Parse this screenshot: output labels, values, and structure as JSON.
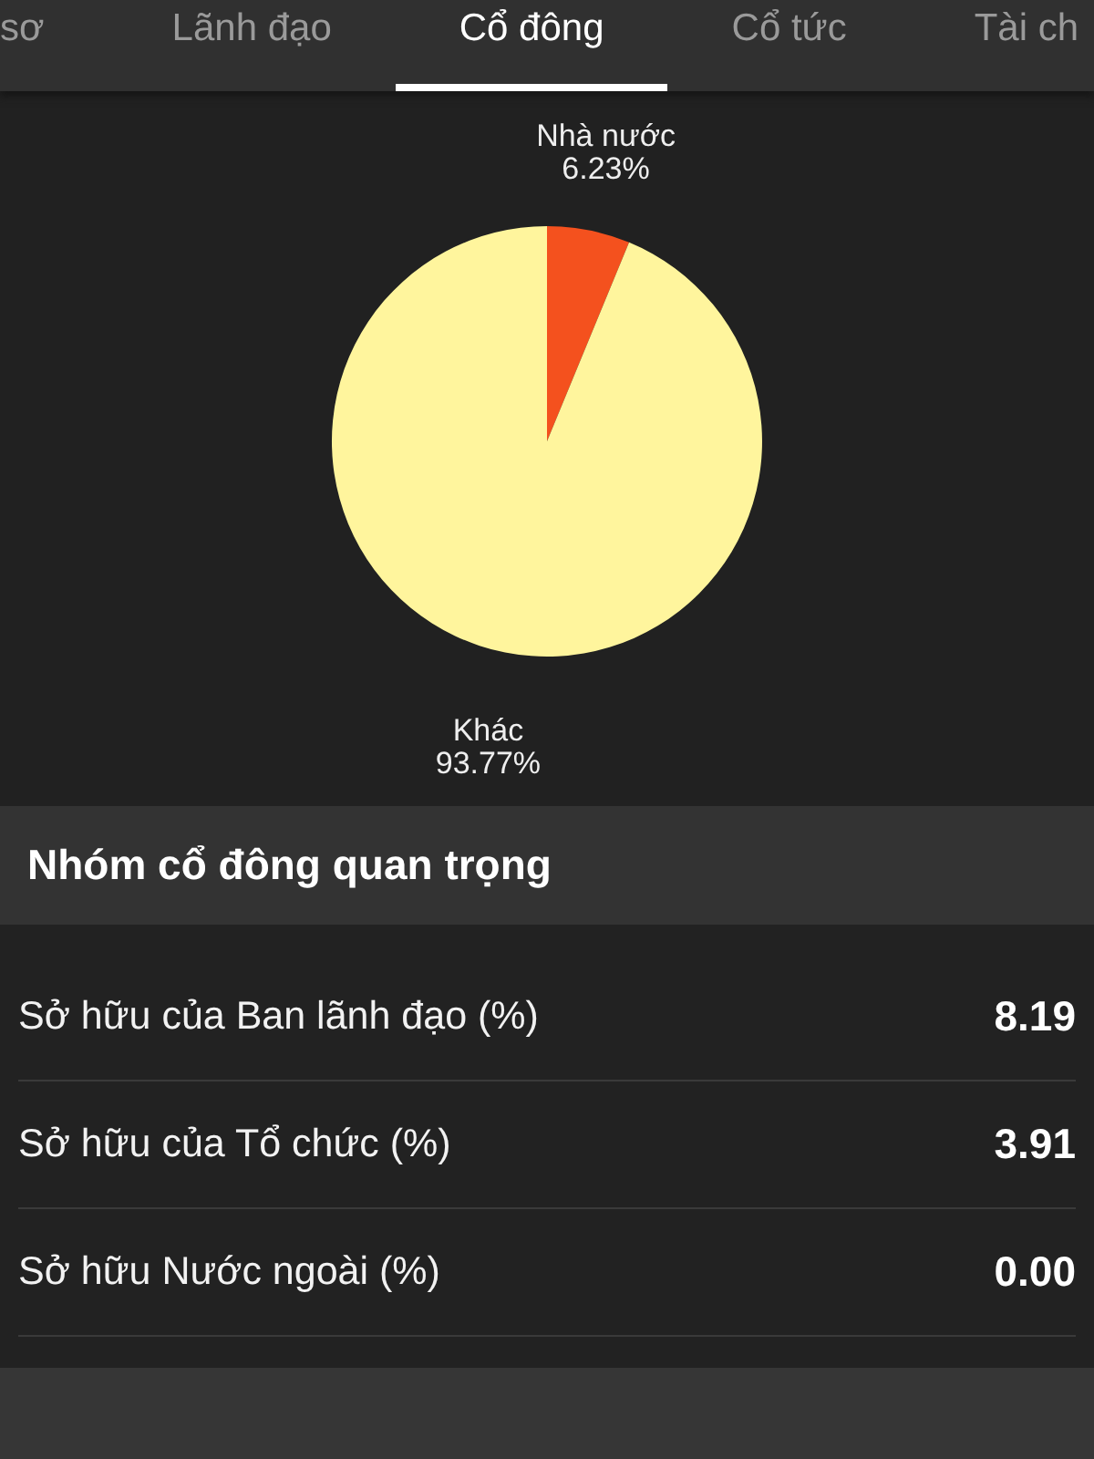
{
  "tabs": [
    {
      "label": "sơ",
      "selected": false
    },
    {
      "label": "Lãnh đạo",
      "selected": false
    },
    {
      "label": "Cổ đông",
      "selected": true
    },
    {
      "label": "Cổ tức",
      "selected": false
    },
    {
      "label": "Tài ch",
      "selected": false
    }
  ],
  "ownership_chart": {
    "chart_data": {
      "type": "pie",
      "categories": [
        "Nhà nước",
        "Khác"
      ],
      "values": [
        6.23,
        93.77
      ],
      "value_labels": [
        "6.23%",
        "93.77%"
      ],
      "colors": [
        "#f4511e",
        "#fff59d"
      ]
    }
  },
  "key_shareholders": {
    "title": "Nhóm cổ đông quan trọng",
    "rows": [
      {
        "label": "Sở hữu của Ban lãnh đạo (%)",
        "value": "8.19"
      },
      {
        "label": "Sở hữu của Tổ chức (%)",
        "value": "3.91"
      },
      {
        "label": "Sở hữu Nước ngoài (%)",
        "value": "0.00"
      }
    ]
  }
}
